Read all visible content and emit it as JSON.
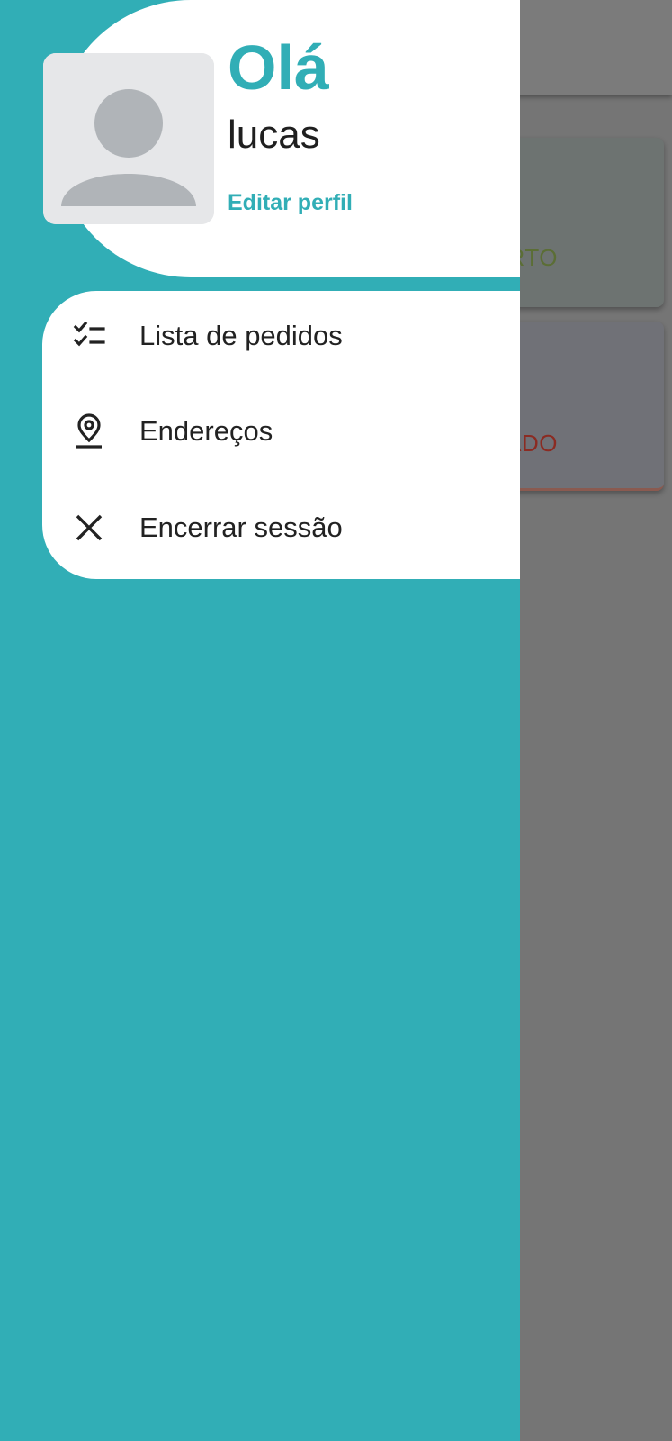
{
  "colors": {
    "accent": "#31aeb6",
    "drawer_background": "#31aeb6",
    "scrim": "#757575",
    "text_dark": "#222222",
    "avatar_bg": "#e6e7e9",
    "avatar_figure": "#b0b4b8"
  },
  "drawer": {
    "header": {
      "greeting": "Olá",
      "username": "lucas",
      "edit_profile_label": "Editar perfil",
      "avatar_icon": "person-placeholder-icon"
    },
    "menu": {
      "items": [
        {
          "label": "Lista de pedidos",
          "icon": "checklist-icon"
        },
        {
          "label": "Endereços",
          "icon": "location-pin-icon"
        },
        {
          "label": "Encerrar sessão",
          "icon": "close-icon"
        }
      ]
    }
  },
  "background_app": {
    "cards": [
      {
        "status_fragment": "RTO",
        "status_color": "#5b6e35"
      },
      {
        "status_fragment": "HADO",
        "status_color": "#8b2b22"
      }
    ]
  }
}
